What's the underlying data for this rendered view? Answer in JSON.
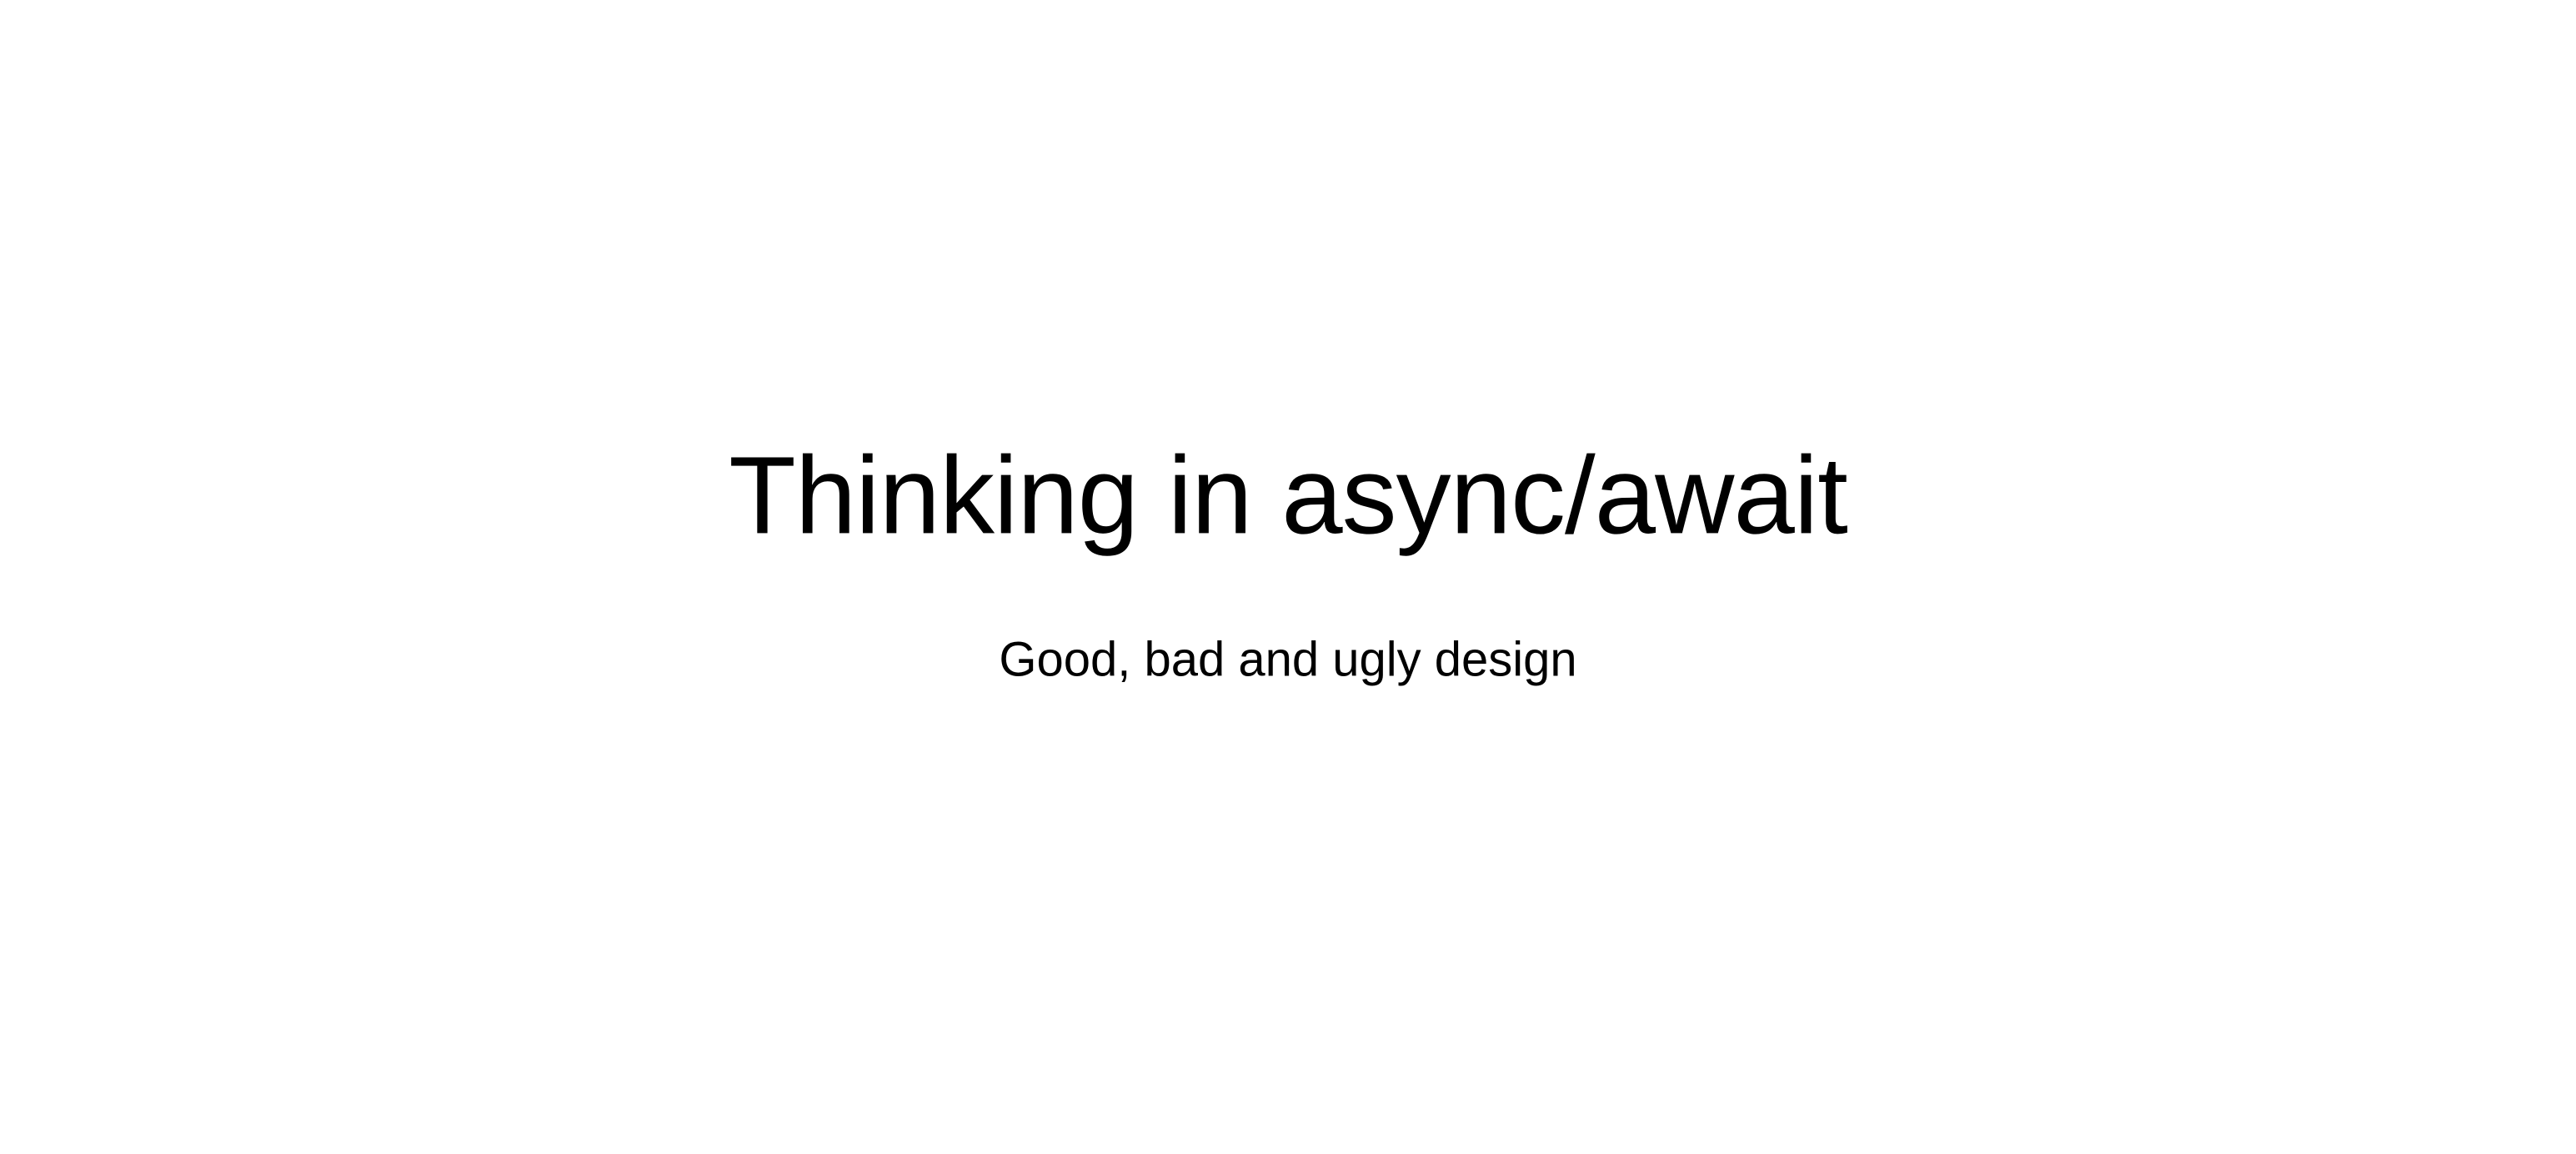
{
  "slide": {
    "title": "Thinking in async/await",
    "subtitle": "Good, bad and ugly design"
  }
}
